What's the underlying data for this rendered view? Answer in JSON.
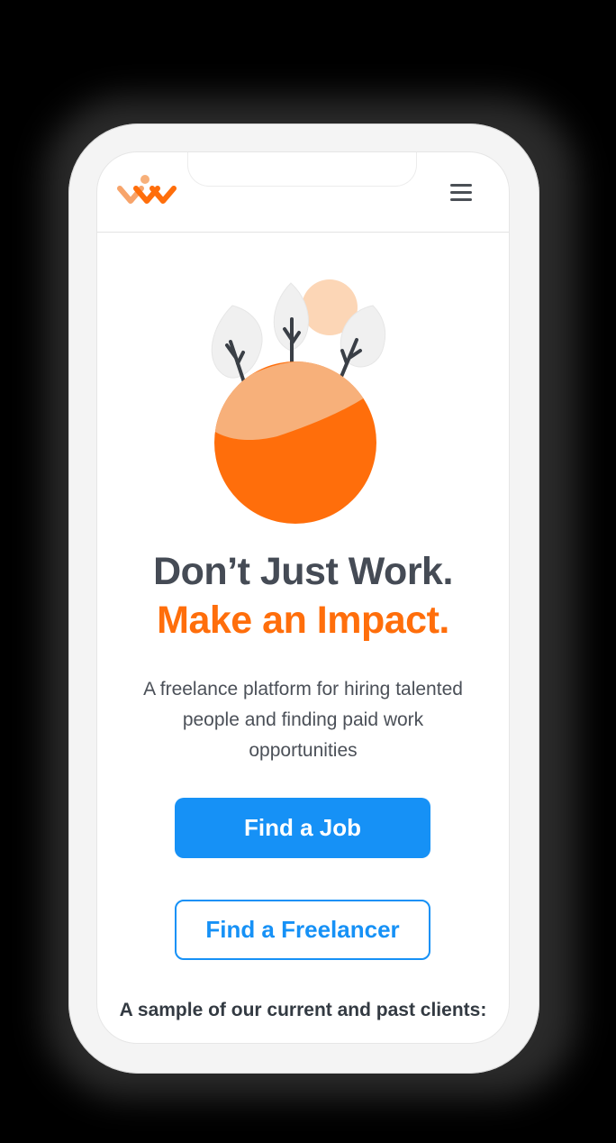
{
  "header": {
    "logo_icon": "brand-logo-icon",
    "menu_icon": "hamburger-menu-icon"
  },
  "hero": {
    "illustration_icon": "planet-with-trees-illustration",
    "headline_line1": "Don’t Just Work.",
    "headline_line2": "Make an Impact.",
    "subtitle": "A freelance platform for hiring talented people and finding paid work opportunities"
  },
  "actions": {
    "find_job_label": "Find a Job",
    "find_freelancer_label": "Find a Freelancer"
  },
  "clients": {
    "heading": "A sample of our current and past clients:"
  },
  "colors": {
    "brand_orange": "#ff6e0b",
    "primary_blue": "#1691f6",
    "text_dark": "#454b55"
  }
}
